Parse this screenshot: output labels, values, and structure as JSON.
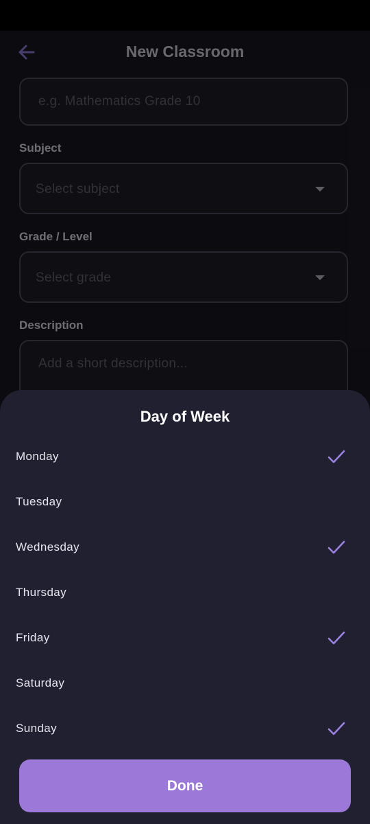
{
  "app_bar": {
    "title": "New Classroom",
    "back_icon": "arrow-back-icon"
  },
  "form": {
    "name_placeholder": "e.g. Mathematics Grade 10",
    "subject_label": "Subject",
    "subject_placeholder": "Select subject",
    "grade_label": "Grade / Level",
    "grade_placeholder": "Select grade",
    "description_label": "Description",
    "description_placeholder": "Add a short description..."
  },
  "sheet": {
    "title": "Day of Week",
    "days": [
      {
        "label": "Monday",
        "selected": true
      },
      {
        "label": "Tuesday",
        "selected": false
      },
      {
        "label": "Wednesday",
        "selected": true
      },
      {
        "label": "Thursday",
        "selected": false
      },
      {
        "label": "Friday",
        "selected": true
      },
      {
        "label": "Saturday",
        "selected": false
      },
      {
        "label": "Sunday",
        "selected": true
      }
    ],
    "done_label": "Done"
  },
  "colors": {
    "accent": "#9c79d9",
    "check": "#9b82e0",
    "sheet_bg": "#212031",
    "screen_bg": "#131218"
  }
}
